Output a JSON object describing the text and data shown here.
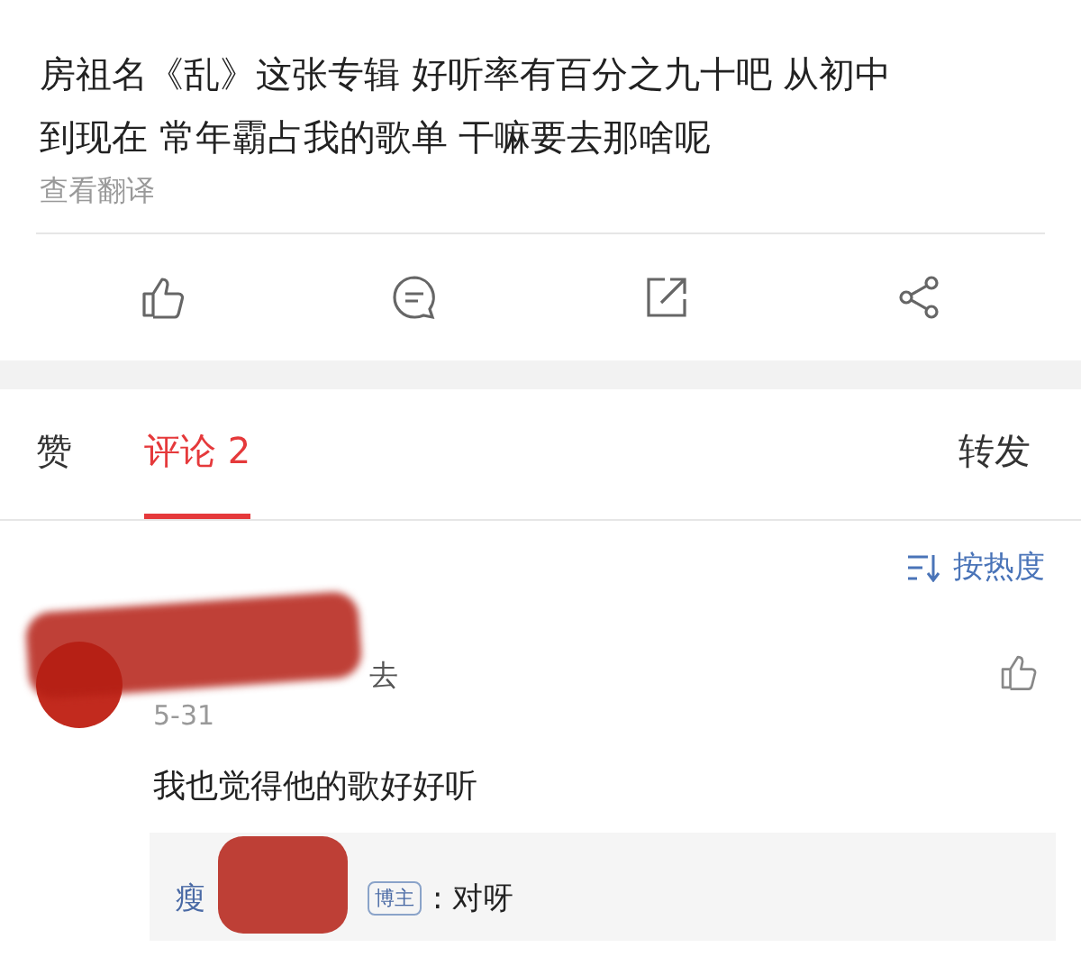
{
  "post": {
    "text_lines": [
      "房祖名《乱》这张专辑 好听率有百分之九十吧 从初中",
      "到现在 常年霸占我的歌单  干嘛要去那啥呢"
    ],
    "translate": "查看翻译"
  },
  "actions": [
    {
      "kind": "like"
    },
    {
      "kind": "comment"
    },
    {
      "kind": "repost"
    },
    {
      "kind": "share"
    }
  ],
  "tabs": [
    {
      "label": "赞",
      "selected": false
    },
    {
      "label": "评论 2",
      "selected": true
    },
    {
      "label": "转发",
      "selected": false
    }
  ],
  "sort": {
    "label": "按热度"
  },
  "comments": [
    {
      "author_visible": "去",
      "date": "5-31",
      "text": "我也觉得他的歌好好听",
      "reply": {
        "author_visible": "瘦",
        "badge": "博主",
        "text": ": 对呀"
      }
    }
  ]
}
